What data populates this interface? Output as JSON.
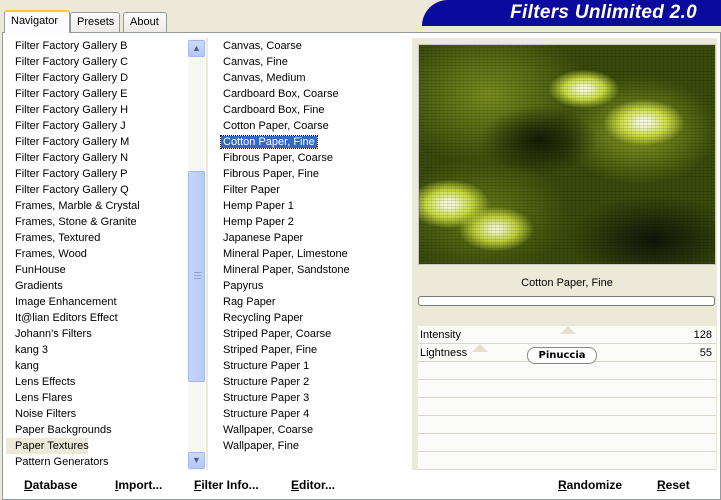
{
  "tabs": [
    {
      "label": "Navigator"
    },
    {
      "label": "Presets"
    },
    {
      "label": "About"
    }
  ],
  "app_title": "Filters Unlimited 2.0",
  "categories": [
    "Filter Factory Gallery B",
    "Filter Factory Gallery C",
    "Filter Factory Gallery D",
    "Filter Factory Gallery E",
    "Filter Factory Gallery H",
    "Filter Factory Gallery J",
    "Filter Factory Gallery M",
    "Filter Factory Gallery N",
    "Filter Factory Gallery P",
    "Filter Factory Gallery Q",
    "Frames, Marble & Crystal",
    "Frames, Stone & Granite",
    "Frames, Textured",
    "Frames, Wood",
    "FunHouse",
    "Gradients",
    "Image Enhancement",
    "It@lian Editors Effect",
    "Johann's Filters",
    "kang 3",
    "kang",
    "Lens Effects",
    "Lens Flares",
    "Noise Filters",
    "Paper Backgrounds",
    "Paper Textures",
    "Pattern Generators"
  ],
  "selected_category": "Paper Textures",
  "filters": [
    "Canvas, Coarse",
    "Canvas, Fine",
    "Canvas, Medium",
    "Cardboard Box, Coarse",
    "Cardboard Box, Fine",
    "Cotton Paper, Coarse",
    "Cotton Paper, Fine",
    "Fibrous Paper, Coarse",
    "Fibrous Paper, Fine",
    "Filter Paper",
    "Hemp Paper 1",
    "Hemp Paper 2",
    "Japanese Paper",
    "Mineral Paper, Limestone",
    "Mineral Paper, Sandstone",
    "Papyrus",
    "Rag Paper",
    "Recycling Paper",
    "Striped Paper, Coarse",
    "Striped Paper, Fine",
    "Structure Paper 1",
    "Structure Paper 2",
    "Structure Paper 3",
    "Structure Paper 4",
    "Wallpaper, Coarse",
    "Wallpaper, Fine"
  ],
  "selected_filter": "Cotton Paper, Fine",
  "preview": {
    "filter_name": "Cotton Paper, Fine"
  },
  "sliders": [
    {
      "name": "Intensity",
      "value": "128"
    },
    {
      "name": "Lightness",
      "value": "55"
    }
  ],
  "watermark_text": "Pinuccia",
  "buttons": {
    "database": "Database",
    "import": "Import...",
    "filter_info": "Filter Info...",
    "editor": "Editor...",
    "randomize": "Randomize",
    "reset": "Reset"
  },
  "colors": {
    "banner": "#0a0a9c",
    "selection": "#316ac5",
    "preview_base": "#3a4a0c",
    "preview_highlight": "#d8e86a"
  }
}
